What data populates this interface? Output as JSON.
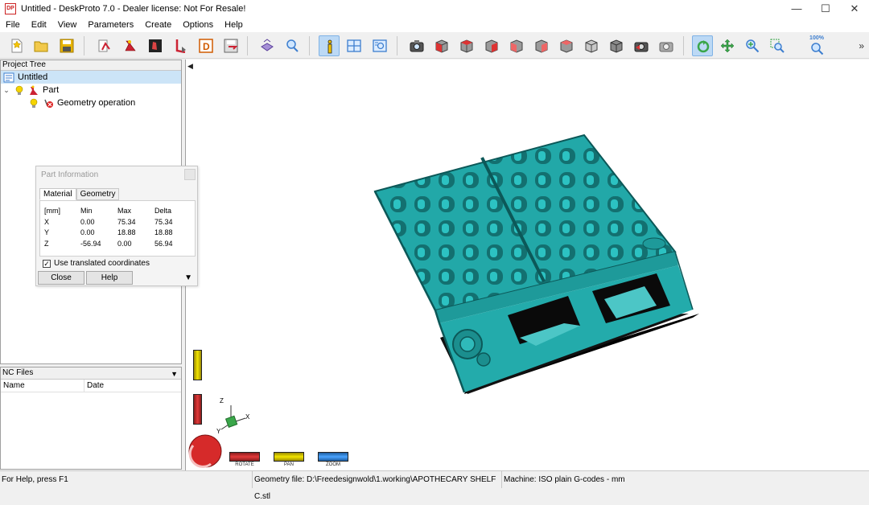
{
  "window": {
    "title": "Untitled - DeskProto 7.0 - Dealer license: Not For Resale!",
    "app_icon_text": "DP",
    "minimize": "—",
    "maximize": "☐",
    "close": "✕"
  },
  "menu": [
    "File",
    "Edit",
    "View",
    "Parameters",
    "Create",
    "Options",
    "Help"
  ],
  "toolbar": {
    "zoom_label": "100%",
    "more": "»"
  },
  "project_tree": {
    "header": "Project Tree",
    "root": "Untitled",
    "part": "Part",
    "operation": "Geometry operation"
  },
  "nc_files": {
    "header": "NC Files",
    "col_name": "Name",
    "col_date": "Date"
  },
  "part_info": {
    "title": "Part Information",
    "tabs": [
      "Material",
      "Geometry"
    ],
    "unit": "[mm]",
    "headers": [
      "Min",
      "Max",
      "Delta"
    ],
    "rows": [
      {
        "axis": "X",
        "min": "0.00",
        "max": "75.34",
        "delta": "75.34"
      },
      {
        "axis": "Y",
        "min": "0.00",
        "max": "18.88",
        "delta": "18.88"
      },
      {
        "axis": "Z",
        "min": "-56.94",
        "max": "0.00",
        "delta": "56.94"
      }
    ],
    "checkbox_label": "Use translated coordinates",
    "checkbox_mark": "✓",
    "close": "Close",
    "help": "Help"
  },
  "axes": {
    "x": "X",
    "y": "Y",
    "z": "Z"
  },
  "controls": {
    "rotate": "ROTATE",
    "pan": "PAN",
    "zoom": "ZOOM"
  },
  "status": {
    "help": "For Help, press F1",
    "geometry": "Geometry file: D:\\Freedesignwold\\1.working\\APOTHECARY SHELF C.stl",
    "machine": "Machine: ISO plain G-codes - mm"
  },
  "colors": {
    "model": "#20a6a6",
    "model_dark": "#157878",
    "selection": "#cce4f7"
  }
}
